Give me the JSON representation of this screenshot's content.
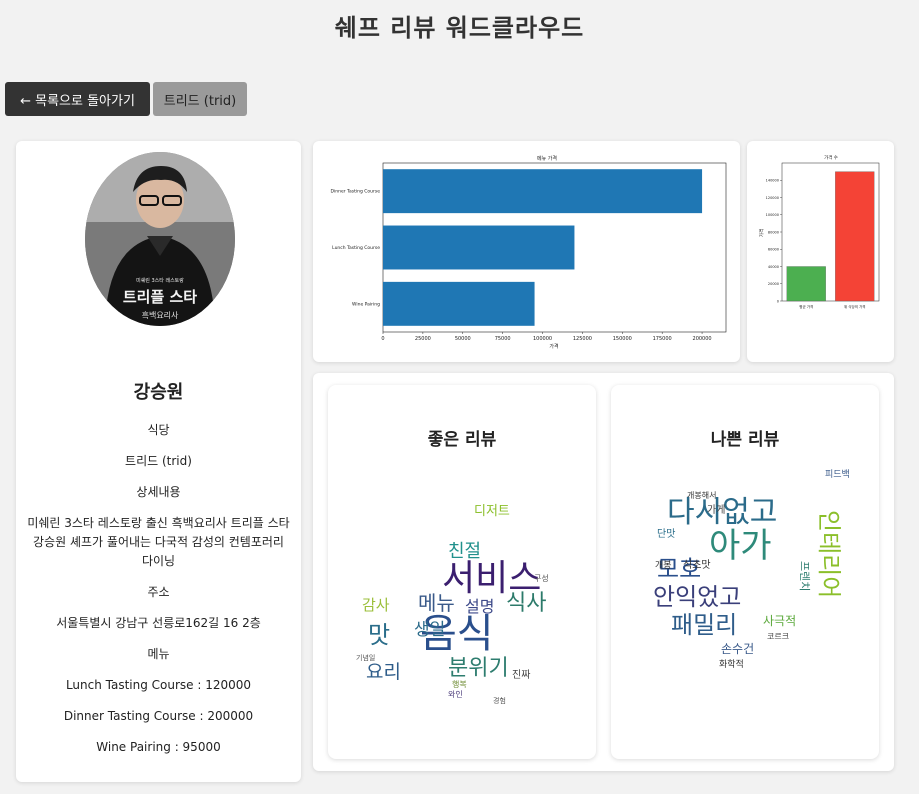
{
  "page_title": "쉐프 리뷰 워드클라우드",
  "buttons": {
    "back": "← 목록으로 돌아가기",
    "restaurant": "트리드 (trid)"
  },
  "chef": {
    "name": "강승원",
    "photo_caption_1": "트리플 스타",
    "photo_caption_2": "흑백요리사",
    "restaurant_label": "식당",
    "restaurant": "트리드 (trid)",
    "detail_label": "상세내용",
    "detail": "미쉐린 3스타 레스토랑 출신 흑백요리사 트리플 스타 강승원 셰프가 풀어내는 다국적 감성의 컨템포러리 다이닝",
    "address_label": "주소",
    "address": "서울특별시 강남구 선릉로162길 16 2층",
    "menu_label": "메뉴",
    "menu": [
      "Lunch Tasting Course : 120000",
      "Dinner Tasting Course : 200000",
      "Wine Pairing : 95000"
    ]
  },
  "chart_data": [
    {
      "type": "bar",
      "orientation": "horizontal",
      "title": "메뉴 가격",
      "xlabel": "가격",
      "categories": [
        "Dinner Tasting Course",
        "Lunch Tasting Course",
        "Wine Pairing"
      ],
      "values": [
        200000,
        120000,
        95000
      ],
      "xlim": [
        0,
        215000
      ],
      "xticks": [
        0,
        25000,
        50000,
        75000,
        100000,
        125000,
        150000,
        175000,
        200000
      ],
      "color": "#1f77b4"
    },
    {
      "type": "bar",
      "title": "가격 수",
      "ylabel": "가격",
      "categories": [
        "평균 가격",
        "위 식당의 가격"
      ],
      "values": [
        40000,
        150000
      ],
      "ylim": [
        0,
        160000
      ],
      "yticks": [
        0,
        20000,
        40000,
        60000,
        80000,
        100000,
        120000,
        140000
      ],
      "colors": [
        "#4caf50",
        "#f44336"
      ]
    }
  ],
  "wordclouds": {
    "good": {
      "title": "좋은 리뷰",
      "words": [
        "서비스",
        "음식",
        "분위기",
        "메뉴",
        "생일",
        "설명",
        "식사",
        "친절",
        "감사",
        "맛",
        "요리",
        "기념일",
        "진짜",
        "행복",
        "와인",
        "디저트",
        "구성",
        "경험"
      ]
    },
    "bad": {
      "title": "나쁜 리뷰",
      "words": [
        "다시없고",
        "아가",
        "모호",
        "안익었고",
        "패밀리",
        "인테리어",
        "손수건",
        "사극적",
        "단맛",
        "개봉",
        "식초맛",
        "피드백",
        "코르크",
        "화학적",
        "프렌치",
        "가게",
        "개봉해서"
      ]
    }
  }
}
